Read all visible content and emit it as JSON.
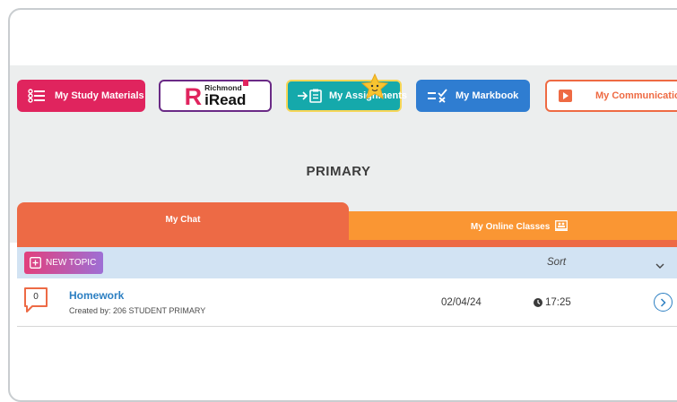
{
  "nav": {
    "study_materials": "My Study Materials",
    "iread_small": "Richmond",
    "iread_big": "iRead",
    "iread_letter": "R",
    "assignments": "My Assignments",
    "markbook": "My Markbook",
    "communications": "My Communications"
  },
  "heading": "PRIMARY",
  "tabs": {
    "chat": "My Chat",
    "online_classes": "My Online Classes"
  },
  "toolbar": {
    "new_topic": "NEW TOPIC",
    "sort": "Sort"
  },
  "topics": [
    {
      "count": "0",
      "title": "Homework",
      "created_by": "Created by:  206 STUDENT PRIMARY",
      "date": "02/04/24",
      "time": "17:25"
    }
  ],
  "colors": {
    "study_materials": "#e0245e",
    "iread_border": "#6a2a86",
    "assignments": "#15a9ab",
    "markbook": "#2f7dd1",
    "communications": "#ee6a43",
    "chat_tab": "#ed6a45",
    "online_tab": "#fa9633",
    "toolbar_bg": "#d2e3f3",
    "link": "#2c7fc2"
  },
  "icons": [
    "list-icon",
    "assignment-icon",
    "star-mascot-icon",
    "checklist-icon",
    "play-icon",
    "video-class-icon",
    "add-topic-icon",
    "chevron-down-icon",
    "chat-bubble-icon",
    "clock-icon",
    "chevron-right-icon"
  ]
}
